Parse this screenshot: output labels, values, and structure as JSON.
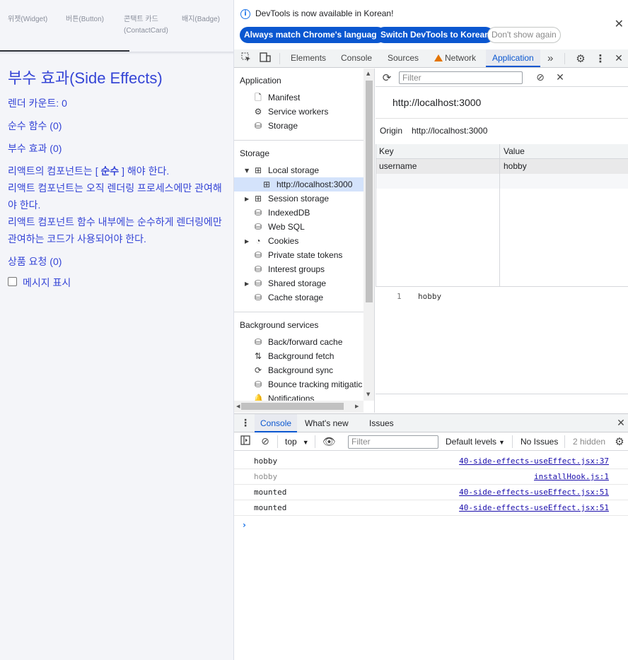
{
  "app": {
    "tabs": [
      "위젯(Widget)",
      "버튼(Button)",
      "콘택트 카드\n(ContactCard)",
      "배지(Badge)"
    ],
    "title": "부수 효과(Side Effects)",
    "render_count": "렌더 카운트: 0",
    "pure_function": "순수 함수 (0)",
    "side_effect": "부수 효과 (0)",
    "para1_pre": "리액트의 컴포넌트는 [ ",
    "para1_bold": "순수",
    "para1_post": " ] 해야 한다.",
    "para2": "리액트 컴포넌트는 오직 렌더링 프로세스에만 관여해야 한다.",
    "para3": "리액트 컴포넌트 함수 내부에는 순수하게 렌더링에만 관여하는 코드가 사용되어야 한다.",
    "product_request": "상품 요청 (0)",
    "checkbox_label": "메시지 표시"
  },
  "infobar": {
    "icon": "info-icon",
    "text": "DevTools is now available in Korean!",
    "btn_match": "Always match Chrome's language",
    "btn_switch": "Switch DevTools to Korean",
    "btn_dismiss": "Don't show again",
    "close": "✕"
  },
  "devtools_tabs": {
    "elements": "Elements",
    "console": "Console",
    "sources": "Sources",
    "network": "Network",
    "application": "Application",
    "more": "»"
  },
  "sidebar": {
    "application_header": "Application",
    "manifest": "Manifest",
    "service_workers": "Service workers",
    "storage": "Storage",
    "storage_header": "Storage",
    "local_storage": "Local storage",
    "local_origin": "http://localhost:3000",
    "session_storage": "Session storage",
    "indexeddb": "IndexedDB",
    "websql": "Web SQL",
    "cookies": "Cookies",
    "private_tokens": "Private state tokens",
    "interest_groups": "Interest groups",
    "shared_storage": "Shared storage",
    "cache_storage": "Cache storage",
    "background_header": "Background services",
    "bf_cache": "Back/forward cache",
    "bg_fetch": "Background fetch",
    "bg_sync": "Background sync",
    "bounce": "Bounce tracking mitigatic",
    "notifications": "Notifications"
  },
  "main_pane": {
    "filter_placeholder": "Filter",
    "origin_title": "http://localhost:3000",
    "origin_label": "Origin",
    "origin_value": "http://localhost:3000",
    "key_header": "Key",
    "value_header": "Value",
    "rows": [
      {
        "key": "username",
        "value": "hobby"
      }
    ],
    "preview_line": "1",
    "preview_value": "hobby"
  },
  "drawer": {
    "tab_console": "Console",
    "tab_whats_new": "What's new",
    "tab_issues": "Issues",
    "context": "top",
    "filter_placeholder": "Filter",
    "levels": "Default levels",
    "issues": "No Issues",
    "hidden": "2 hidden",
    "logs": [
      {
        "msg": "hobby",
        "src": "40-side-effects-useEffect.jsx:37",
        "muted": false
      },
      {
        "msg": "hobby",
        "src": "installHook.js:1",
        "muted": true
      },
      {
        "msg": "mounted",
        "src": "40-side-effects-useEffect.jsx:51",
        "muted": false
      },
      {
        "msg": "mounted",
        "src": "40-side-effects-useEffect.jsx:51",
        "muted": false
      }
    ],
    "prompt": "›"
  }
}
